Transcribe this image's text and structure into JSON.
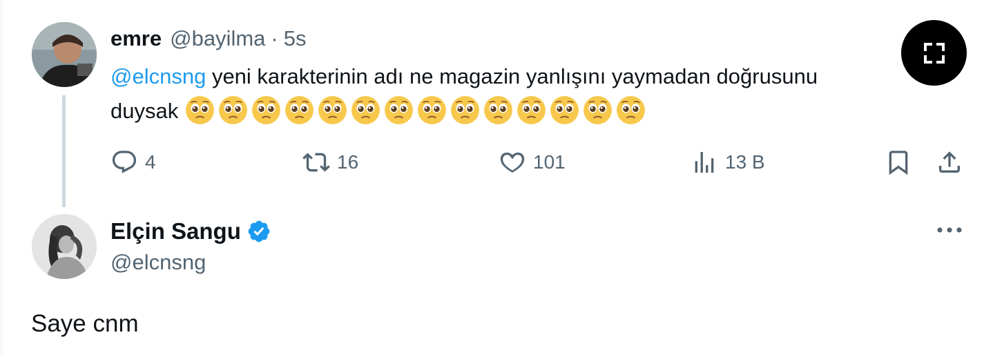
{
  "parent_tweet": {
    "author_name": "emre",
    "author_handle": "@bayilma",
    "separator": "·",
    "time": "5s",
    "mention": "@elcnsng",
    "text_line1_rest": " yeni karakterinin adı ne magazin yanlışını yaymadan doğrusunu",
    "text_line2": "duysak",
    "emoji_name": "pleading-face-emoji",
    "emoji_count": 14,
    "actions": {
      "replies": "4",
      "retweets": "16",
      "likes": "101",
      "views": "13 B"
    }
  },
  "reply_tweet": {
    "author_name": "Elçin Sangu",
    "author_handle": "@elcnsng",
    "verified": true,
    "text": "Saye cnm"
  },
  "icons": {
    "reply": "speech-bubble-icon",
    "retweet": "retweet-icon",
    "like": "heart-icon",
    "views": "bar-chart-icon",
    "bookmark": "bookmark-icon",
    "share": "share-upload-icon",
    "expand": "expand-fullscreen-icon",
    "more": "more-dots-icon",
    "verified": "verified-badge-icon"
  },
  "colors": {
    "mention": "#1d9bf0",
    "secondary_text": "#536471",
    "verified_badge": "#1d9bf0",
    "thread_line": "#cfd9de"
  }
}
